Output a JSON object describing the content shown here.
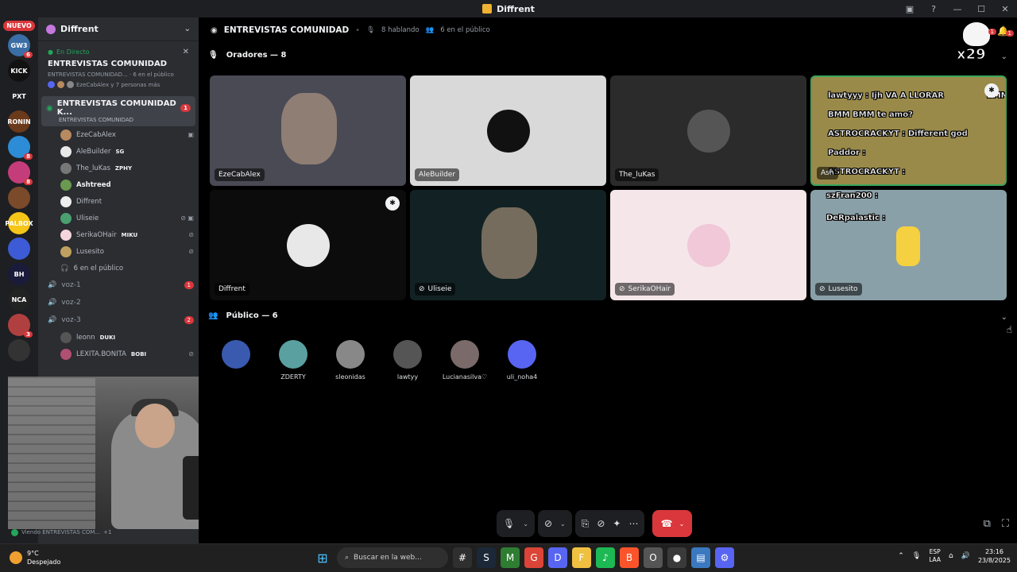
{
  "window": {
    "title": "Diffrent"
  },
  "rail": {
    "new_badge": "NUEVO",
    "servers": [
      {
        "label": "GW3",
        "color": "#3a6ea5",
        "badge": "6"
      },
      {
        "label": "KICK",
        "color": "#111111",
        "badge": ""
      },
      {
        "label": "PXT",
        "color": "#1e1f22",
        "badge": ""
      },
      {
        "label": "RONIN",
        "color": "#6b3a1a",
        "badge": ""
      },
      {
        "label": "",
        "color": "#2d8cd6",
        "badge": "8"
      },
      {
        "label": "",
        "color": "#c43d7a",
        "badge": "8"
      },
      {
        "label": "",
        "color": "#7a4a2a",
        "badge": ""
      },
      {
        "label": "PALBOX",
        "color": "#f5c518",
        "badge": ""
      },
      {
        "label": "",
        "color": "#3d5bd6",
        "badge": ""
      },
      {
        "label": "BH",
        "color": "#1a1a3a",
        "badge": ""
      },
      {
        "label": "NCA",
        "color": "#222222",
        "badge": ""
      },
      {
        "label": "",
        "color": "#b04040",
        "badge": "3"
      },
      {
        "label": "",
        "color": "#333333",
        "badge": ""
      }
    ]
  },
  "sidebar": {
    "server_name": "Diffrent",
    "live": {
      "status": "En Directo",
      "title": "ENTREVISTAS COMUNIDAD",
      "subtitle": "ENTREVISTAS COMUNIDAD... · 6 en el público",
      "participants": "EzeCabAlex y 7 personas más"
    },
    "active_channel": {
      "name": "ENTREVISTAS COMUNIDAD K...",
      "topic": "ENTREVISTAS COMUNIDAD",
      "badge": "1"
    },
    "stage_users": [
      {
        "name": "EzeCabAlex",
        "tag": "",
        "color": "#b88a60",
        "icon": "▣",
        "bold": false
      },
      {
        "name": "AleBuilder",
        "tag": "SG",
        "color": "#e8e8e8",
        "icon": "",
        "bold": false
      },
      {
        "name": "The_luKas",
        "tag": "ZPHY",
        "color": "#777777",
        "icon": "",
        "bold": false
      },
      {
        "name": "Ashtreed",
        "tag": "",
        "color": "#6a9a50",
        "icon": "",
        "bold": true
      },
      {
        "name": "Diffrent",
        "tag": "",
        "color": "#eeeeee",
        "icon": "",
        "bold": false
      },
      {
        "name": "Uliseie",
        "tag": "",
        "color": "#4aa070",
        "icon": "⊘ ▣",
        "bold": false
      },
      {
        "name": "SerikaOHair",
        "tag": "MIKU",
        "color": "#f5d5dd",
        "icon": "⊘",
        "bold": false
      },
      {
        "name": "Lusesito",
        "tag": "",
        "color": "#c0a060",
        "icon": "⊘",
        "bold": false
      }
    ],
    "audience_line": "6 en el público",
    "voice_channels": [
      {
        "name": "voz-1",
        "badge": "1"
      },
      {
        "name": "voz-2",
        "badge": ""
      },
      {
        "name": "voz-3",
        "badge": "2"
      }
    ],
    "voz3_users": [
      {
        "name": "leonn",
        "tag": "DUKI",
        "color": "#555555",
        "icon": "",
        "bold": false
      },
      {
        "name": "LEXITA.BONITA",
        "tag": "BOBI",
        "color": "#b05070",
        "icon": "⊘",
        "bold": false
      }
    ],
    "viewing": "Viendo ENTREVISTAS COM...",
    "viewing_extra": "+1"
  },
  "main": {
    "stage_title": "ENTREVISTAS COMUNIDAD",
    "speaking": "8 hablando",
    "public_count": "6 en el público",
    "goose_text": "x29",
    "goose_badge": "1",
    "bell_badge": "1",
    "speakers_header": "Oradores — 8",
    "public_header": "Público — 6",
    "tiles": [
      {
        "name": "EzeCabAlex",
        "bg": "#4a4a55",
        "type": "video"
      },
      {
        "name": "AleBuilder",
        "bg": "#d9d9d9",
        "type": "avatar",
        "avatar_color": "#111111"
      },
      {
        "name": "The_luKas",
        "bg": "#2b2b2b",
        "type": "avatar",
        "avatar_color": "#555555"
      },
      {
        "name": "Ash",
        "bg": "#9a8a4a",
        "type": "chat"
      },
      {
        "name": "Diffrent",
        "bg": "#0c0c0c",
        "type": "avatar",
        "avatar_color": "#e8e8e8"
      },
      {
        "name": "Uliseie",
        "bg": "#122224",
        "type": "video"
      },
      {
        "name": "SerikaOHair",
        "bg": "#f5e6ea",
        "type": "avatar",
        "avatar_color": "#f0c8d8"
      },
      {
        "name": "Lusesito",
        "bg": "#8aa0a8",
        "type": "chat2"
      }
    ],
    "chat_overlay": [
      {
        "text": "lawtyyy : Ijh VA A LLORAR",
        "extra": "BMM"
      },
      {
        "text": "BMM BMM te amo?",
        "extra": ""
      },
      {
        "text": "ASTROCRACKYT : Different god",
        "extra": ""
      },
      {
        "text": "Paddor :",
        "extra": ""
      },
      {
        "text": "ASTROCRACKYT :",
        "extra": ""
      }
    ],
    "chat_overlay_2": [
      {
        "text": "szFran200 :"
      },
      {
        "text": "DeRpalastic :"
      }
    ],
    "audience": [
      {
        "name": "",
        "color": "#3a5ab0"
      },
      {
        "name": "ZDERTY",
        "color": "#5aa0a0"
      },
      {
        "name": "sleonidas",
        "color": "#888888"
      },
      {
        "name": "lawtyy",
        "color": "#555555"
      },
      {
        "name": "Lucianasilva♡",
        "color": "#7a6a6a"
      },
      {
        "name": "uli_noha4",
        "color": "#5865f2"
      }
    ]
  },
  "controls": {
    "mic_icon": "🎙",
    "video_icon": "⊘",
    "screen_icon": "⎘",
    "mute_icon": "⊘",
    "activity_icon": "✦",
    "more_icon": "⋯",
    "leave_icon": "☎",
    "popout_icon": "⧉",
    "fullscreen_icon": "⛶"
  },
  "taskbar": {
    "temperature": "9°C",
    "condition": "Despejado",
    "search_placeholder": "Buscar en la web...",
    "lang_1": "ESP",
    "lang_2": "LAA",
    "time": "23:16",
    "date": "23/8/2025",
    "apps": [
      {
        "label": "#",
        "color": "#2f2f2f"
      },
      {
        "label": "S",
        "color": "#1b2838"
      },
      {
        "label": "M",
        "color": "#2e7d32"
      },
      {
        "label": "G",
        "color": "#db4437"
      },
      {
        "label": "D",
        "color": "#5865f2"
      },
      {
        "label": "F",
        "color": "#f0c040"
      },
      {
        "label": "♪",
        "color": "#1db954"
      },
      {
        "label": "B",
        "color": "#fb542b"
      },
      {
        "label": "O",
        "color": "#555555"
      },
      {
        "label": "●",
        "color": "#3a3a3a"
      },
      {
        "label": "▤",
        "color": "#3a78c0"
      },
      {
        "label": "⚙",
        "color": "#5865f2"
      }
    ]
  }
}
